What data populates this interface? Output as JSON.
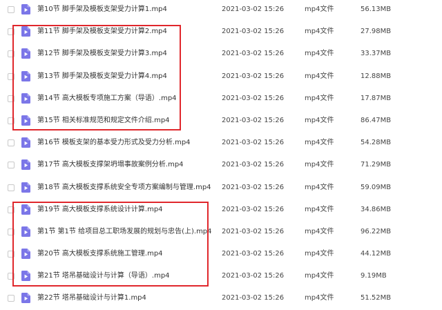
{
  "colors": {
    "icon_purple": "#7b76e8",
    "highlight_red": "#e0262b"
  },
  "file_icon": "video-file-icon",
  "files": [
    {
      "name": "第10节 脚手架及模板支架受力计算1.mp4",
      "date": "2021-03-02 15:26",
      "type": "mp4文件",
      "size": "56.13MB"
    },
    {
      "name": "第11节 脚手架及模板支架受力计算2.mp4",
      "date": "2021-03-02 15:26",
      "type": "mp4文件",
      "size": "27.98MB"
    },
    {
      "name": "第12节 脚手架及模板支架受力计算3.mp4",
      "date": "2021-03-02 15:26",
      "type": "mp4文件",
      "size": "33.37MB"
    },
    {
      "name": "第13节 脚手架及模板支架受力计算4.mp4",
      "date": "2021-03-02 15:26",
      "type": "mp4文件",
      "size": "12.88MB"
    },
    {
      "name": "第14节 高大模板专项施工方案（导语）.mp4",
      "date": "2021-03-02 15:26",
      "type": "mp4文件",
      "size": "17.87MB"
    },
    {
      "name": "第15节 相关标准规范和规定文件介绍.mp4",
      "date": "2021-03-02 15:26",
      "type": "mp4文件",
      "size": "86.47MB"
    },
    {
      "name": "第16节 模板支架的基本受力形式及受力分析.mp4",
      "date": "2021-03-02 15:26",
      "type": "mp4文件",
      "size": "54.28MB"
    },
    {
      "name": "第17节 高大模板支撑架坍塌事故案例分析.mp4",
      "date": "2021-03-02 15:26",
      "type": "mp4文件",
      "size": "71.29MB"
    },
    {
      "name": "第18节 高大模板支撑系统安全专项方案编制与管理.mp4",
      "date": "2021-03-02 15:26",
      "type": "mp4文件",
      "size": "59.09MB"
    },
    {
      "name": "第19节 高大模板支撑系统设计计算.mp4",
      "date": "2021-03-02 15:26",
      "type": "mp4文件",
      "size": "34.86MB"
    },
    {
      "name": "第1节 第1节 给项目总工职场发展的规划与忠告(上).mp4",
      "date": "2021-03-02 15:26",
      "type": "mp4文件",
      "size": "96.22MB"
    },
    {
      "name": "第20节 高大模板支撑系统施工管理.mp4",
      "date": "2021-03-02 15:26",
      "type": "mp4文件",
      "size": "44.12MB"
    },
    {
      "name": "第21节 塔吊基础设计与计算（导语）.mp4",
      "date": "2021-03-02 15:26",
      "type": "mp4文件",
      "size": "9.19MB"
    },
    {
      "name": "第22节 塔吊基础设计与计算1.mp4",
      "date": "2021-03-02 15:26",
      "type": "mp4文件",
      "size": "51.52MB"
    }
  ]
}
